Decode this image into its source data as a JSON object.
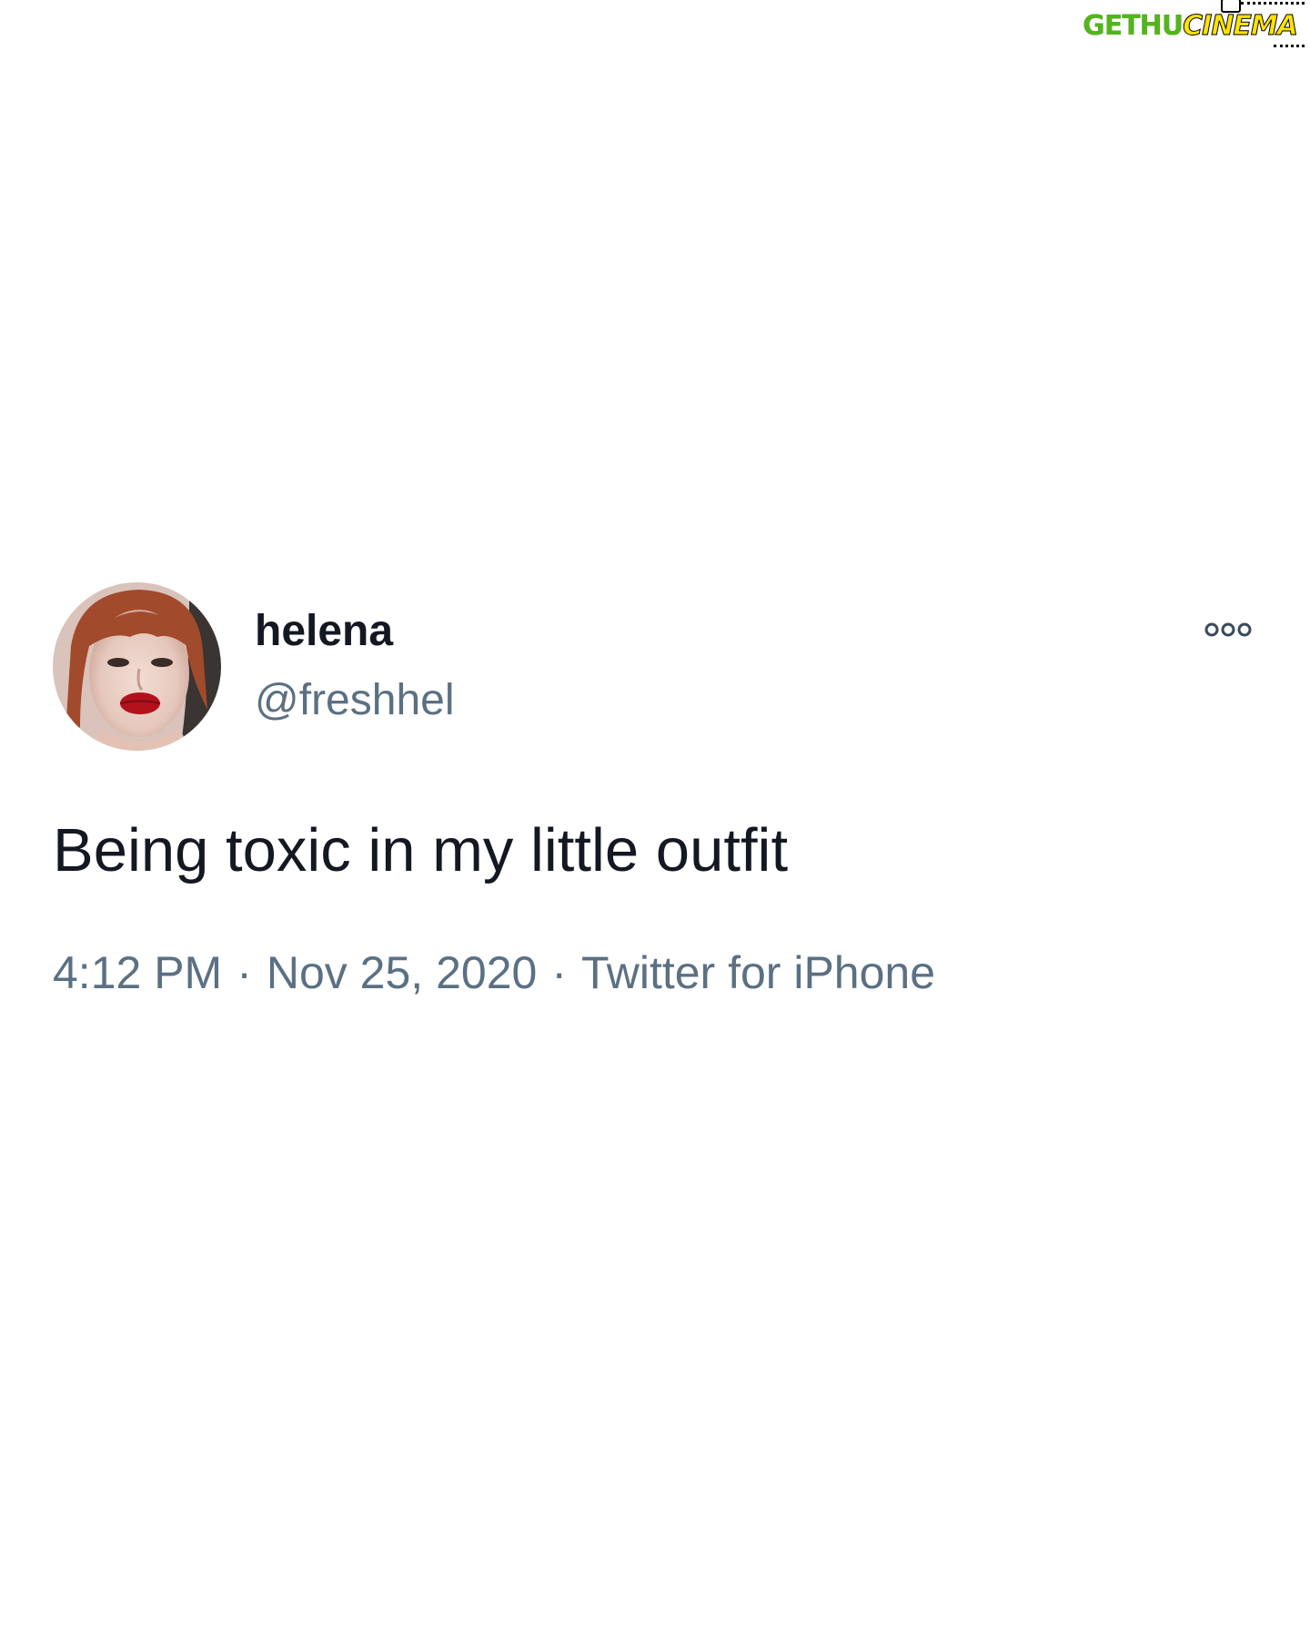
{
  "watermark": {
    "part1": "GETHU",
    "part2": "CINEMA"
  },
  "tweet": {
    "author": {
      "display_name": "helena",
      "handle": "@freshhel"
    },
    "text": "Being toxic in my little outfit",
    "meta": {
      "time": "4:12 PM",
      "date": "Nov 25, 2020",
      "source": "Twitter for iPhone",
      "separator": "·"
    }
  },
  "icons": {
    "more": "more-options-icon",
    "avatar": "avatar"
  }
}
